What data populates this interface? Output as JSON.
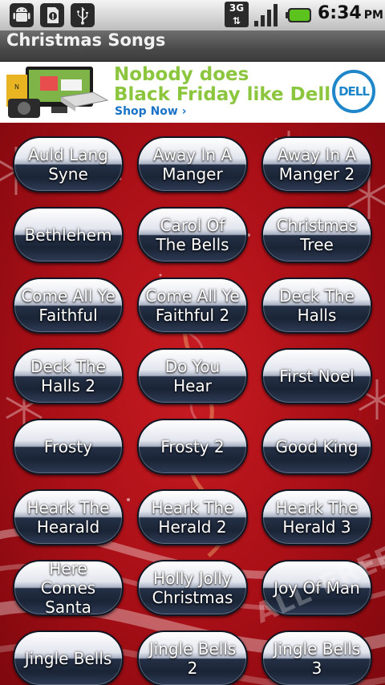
{
  "status_bar": {
    "icons": [
      "android-icon",
      "sd-card-icon",
      "usb-icon"
    ],
    "network": "3G",
    "time": "6:34",
    "ampm": "PM"
  },
  "title_bar": {
    "title": "Christmas Songs"
  },
  "ad": {
    "headline_line1": "Nobody does",
    "headline_line2": "Black Friday like Dell",
    "cta": "Shop Now ›",
    "brand": "DELL",
    "headline_color": "#8cc63f",
    "brand_color": "#1f87c9"
  },
  "songs": [
    "Auld Lang Syne",
    "Away In A Manger",
    "Away In A Manger 2",
    "Bethlehem",
    "Carol Of The Bells",
    "Christmas Tree",
    "Come All Ye Faithful",
    "Come All Ye Faithful 2",
    "Deck The Halls",
    "Deck The Halls 2",
    "Do You Hear",
    "First Noel",
    "Frosty",
    "Frosty 2",
    "Good King",
    "Heark The Hearald",
    "Heark The Herald 2",
    "Heark The Herald 3",
    "Here Comes Santa",
    "Holly Jolly Christmas",
    "Joy Of Man",
    "Jingle Bells",
    "Jingle Bells 2",
    "Jingle Bells 3"
  ],
  "watermark": "ALL-FREE",
  "colors": {
    "background_red": "#b5131a",
    "button_navy": "#1a2436"
  }
}
